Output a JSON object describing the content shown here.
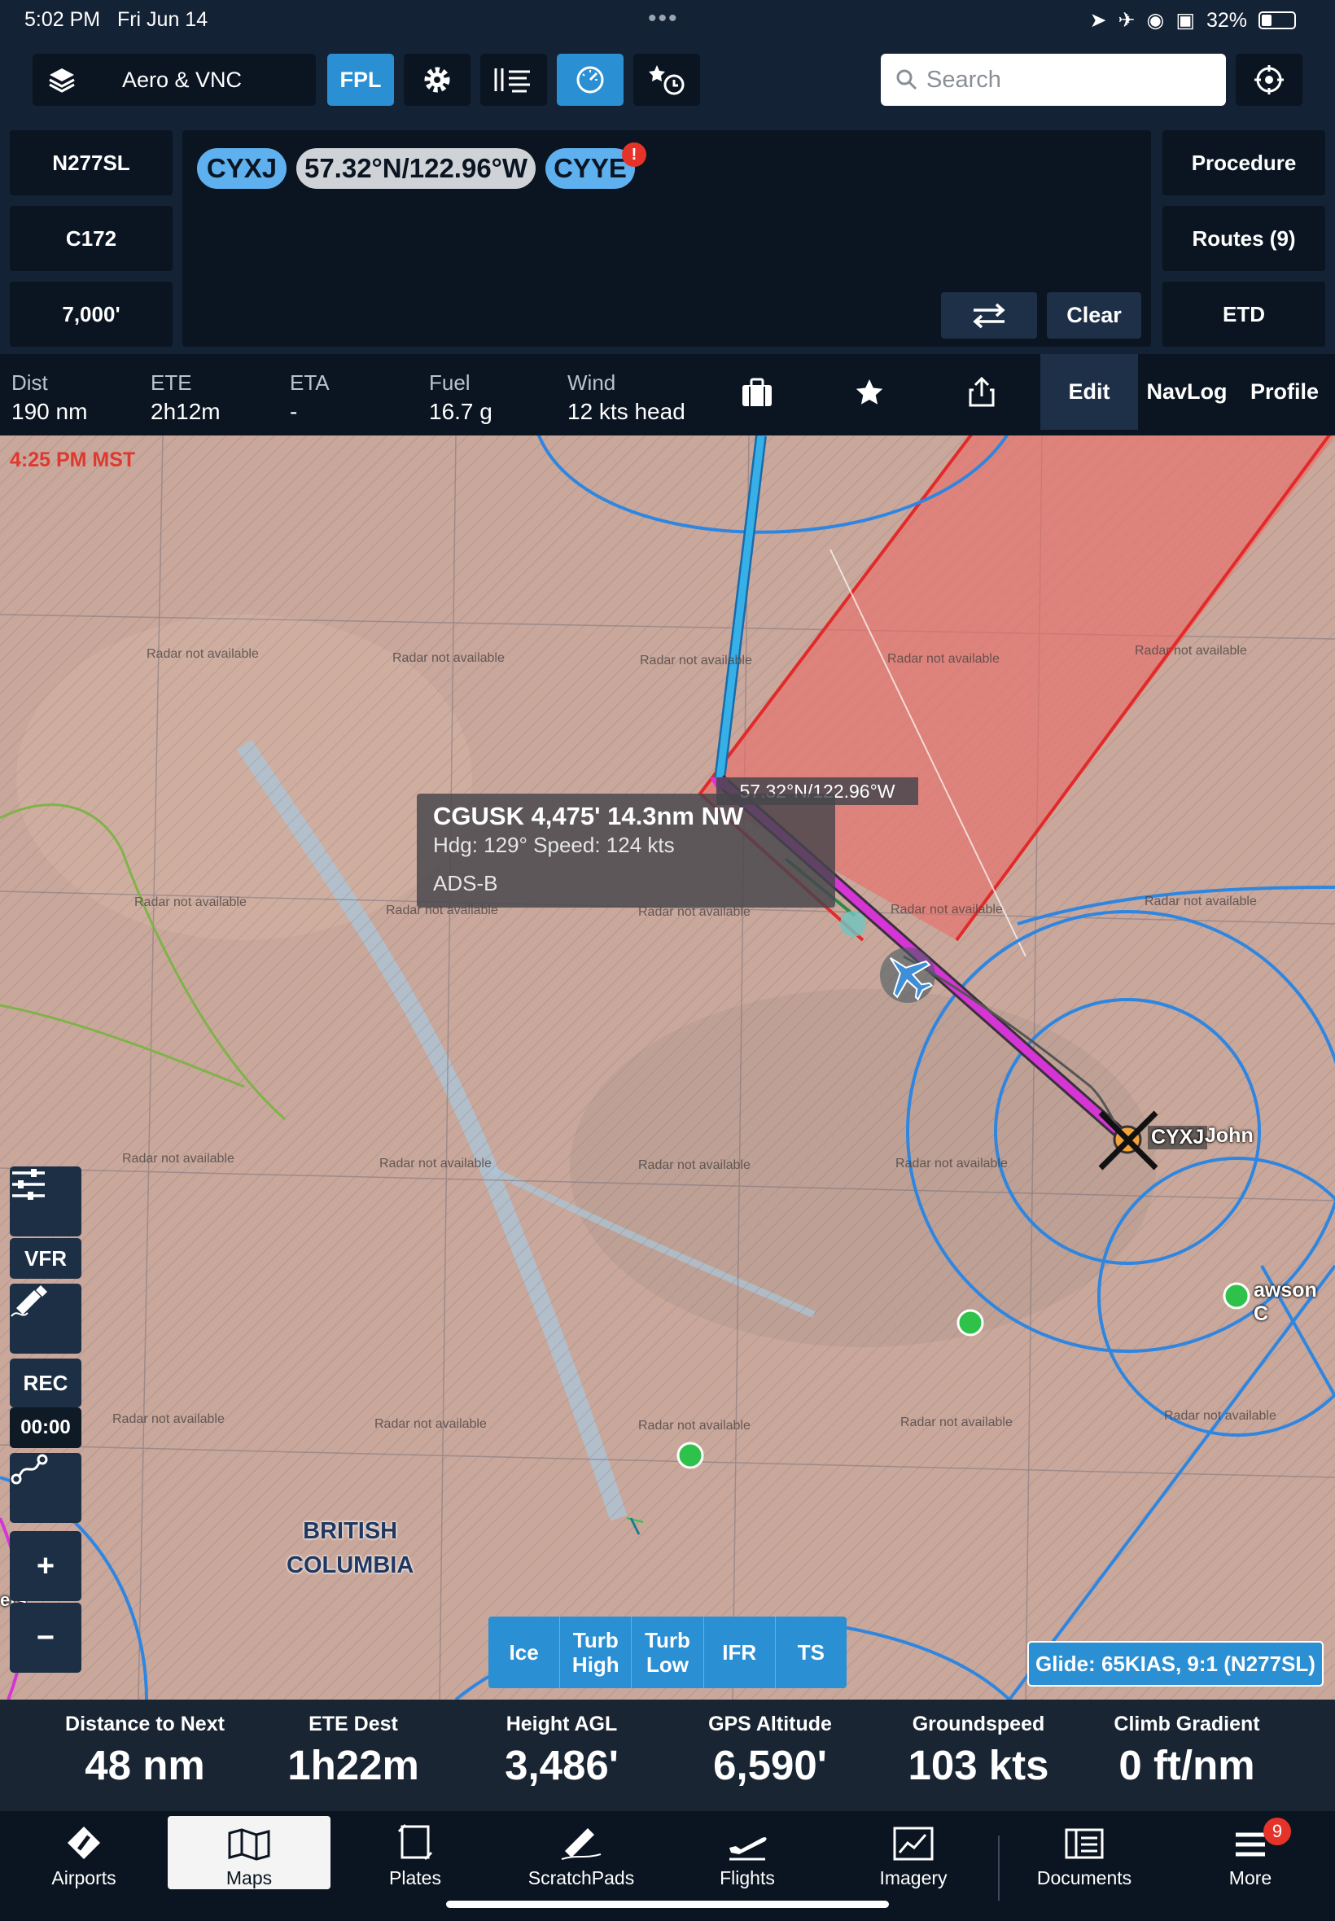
{
  "status_bar": {
    "time": "5:02 PM",
    "date": "Fri Jun 14",
    "battery": "32%",
    "battery_level": 0.32
  },
  "toolbar": {
    "layer_label": "Aero & VNC",
    "fpl_label": "FPL",
    "search_placeholder": "Search",
    "icons": [
      "layers-icon",
      "gear-icon",
      "wind-icon",
      "gauge-icon",
      "favorites-timer-icon",
      "crosshair-icon"
    ]
  },
  "flight_plan": {
    "aircraft_id": "N277SL",
    "aircraft_type": "C172",
    "altitude": "7,000'",
    "route": [
      "CYXJ",
      "57.32°N/122.96°W",
      "CYYE"
    ],
    "alert_mark": "!",
    "clear_label": "Clear",
    "procedure_label": "Procedure",
    "routes_label": "Routes (9)",
    "etd_label": "ETD"
  },
  "info_strip": {
    "stats": [
      {
        "label": "Dist",
        "value": "190 nm"
      },
      {
        "label": "ETE",
        "value": "2h12m"
      },
      {
        "label": "ETA",
        "value": "-"
      },
      {
        "label": "Fuel",
        "value": "16.7 g"
      },
      {
        "label": "Wind",
        "value": "12 kts head"
      }
    ],
    "tabs": [
      "Edit",
      "NavLog",
      "Profile"
    ],
    "active_tab": "Edit"
  },
  "map": {
    "timestamp": "4:25 PM MST",
    "radar_note": "Radar not available",
    "traffic_popup": {
      "line1": "CGUSK 4,475' 14.3nm NW",
      "line2": "Hdg: 129° Speed: 124 kts",
      "line3": "ADS-B"
    },
    "coord_tag": "57.32°N/122.96°W",
    "airport_code": "CYXJ",
    "airport_name": "John",
    "town_label": "awson C",
    "region_label_1": "BRITISH",
    "region_label_2": "COLUMBIA",
    "edge_label": "ers",
    "side_controls": {
      "vfr": "VFR",
      "rec": "REC",
      "rec_time": "00:00",
      "zoom_in": "+",
      "zoom_out": "−"
    },
    "overlays": [
      "Ice",
      "Turb High",
      "Turb Low",
      "IFR",
      "TS"
    ],
    "glide": "Glide: 65KIAS, 9:1 (N277SL)",
    "colors": {
      "route": "#d635d6",
      "tfr_fill": "#e8706a",
      "airspace": "#2f86e0",
      "course_line": "#37b0e8"
    }
  },
  "instruments": [
    {
      "label": "Distance to Next",
      "value": "48 nm"
    },
    {
      "label": "ETE Dest",
      "value": "1h22m"
    },
    {
      "label": "Height AGL",
      "value": "3,486'"
    },
    {
      "label": "GPS Altitude",
      "value": "6,590'"
    },
    {
      "label": "Groundspeed",
      "value": "103 kts"
    },
    {
      "label": "Climb Gradient",
      "value": "0 ft/nm"
    }
  ],
  "tab_bar": {
    "items": [
      "Airports",
      "Maps",
      "Plates",
      "ScratchPads",
      "Flights",
      "Imagery",
      "Documents",
      "More"
    ],
    "active": "Maps",
    "more_badge": "9"
  }
}
